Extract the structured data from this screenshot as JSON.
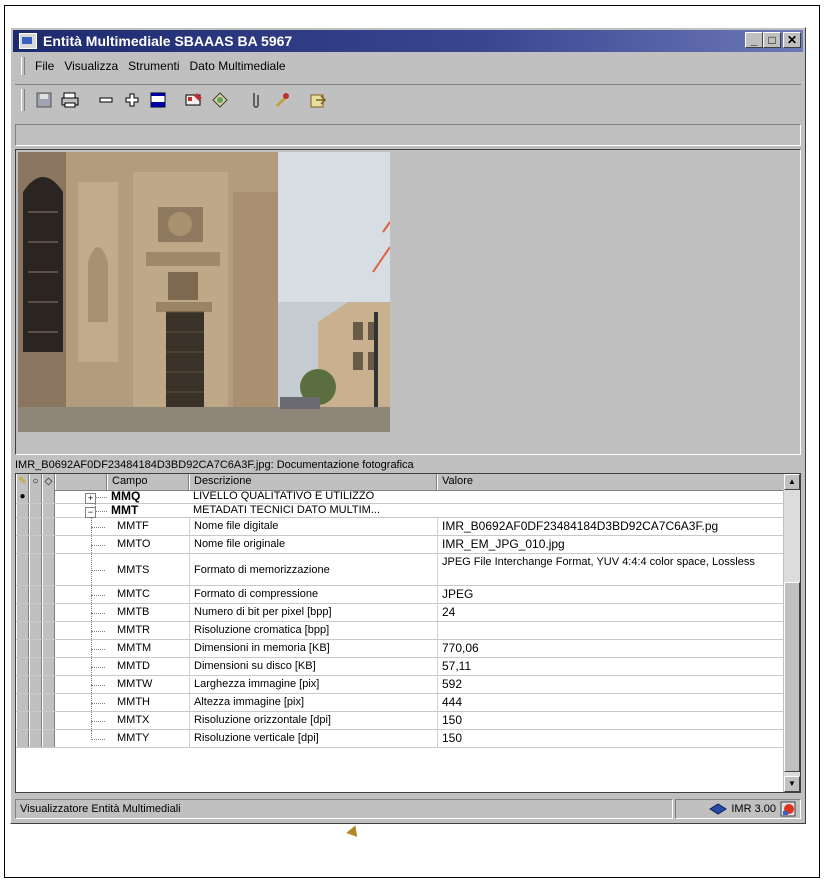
{
  "window": {
    "title": "Entità Multimediale SBAAAS BA 5967"
  },
  "titlebar_buttons": {
    "minimize": "_",
    "maximize": "□",
    "close": "✕"
  },
  "menu": [
    "File",
    "Visualizza",
    "Strumenti",
    "Dato Multimediale"
  ],
  "toolbar": [
    "save-icon",
    "print-icon",
    "remove-icon",
    "add-icon",
    "window-icon",
    "id-card-icon",
    "image-icon",
    "attach-icon",
    "tool-icon",
    "export-icon"
  ],
  "caption": "IMR_B0692AF0DF23484184D3BD92CA7C6A3F.jpg: Documentazione fotografica",
  "grid": {
    "headers": {
      "campo": "Campo",
      "descrizione": "Descrizione",
      "valore": "Valore"
    },
    "groups": [
      {
        "expand": "+",
        "campo": "MMQ",
        "descrizione": "LIVELLO QUALITATIVO E UTILIZZO"
      },
      {
        "expand": "−",
        "campo": "MMT",
        "descrizione": "METADATI TECNICI DATO MULTIM..."
      }
    ],
    "rows": [
      {
        "campo": "MMTF",
        "descrizione": "Nome file digitale",
        "valore": "IMR_B0692AF0DF23484184D3BD92CA7C6A3F.pg"
      },
      {
        "campo": "MMTO",
        "descrizione": "Nome file originale",
        "valore": "IMR_EM_JPG_010.jpg"
      },
      {
        "campo": "MMTS",
        "descrizione": "Formato di memorizzazione",
        "valore": "JPEG File Interchange Format, YUV 4:4:4 color space, Lossless"
      },
      {
        "campo": "MMTC",
        "descrizione": "Formato di compressione",
        "valore": "JPEG"
      },
      {
        "campo": "MMTB",
        "descrizione": "Numero di bit per pixel [bpp]",
        "valore": "24"
      },
      {
        "campo": "MMTR",
        "descrizione": "Risoluzione cromatica [bpp]",
        "valore": ""
      },
      {
        "campo": "MMTM",
        "descrizione": "Dimensioni in memoria [KB]",
        "valore": "770,06"
      },
      {
        "campo": "MMTD",
        "descrizione": "Dimensioni su disco [KB]",
        "valore": "57,11"
      },
      {
        "campo": "MMTW",
        "descrizione": "Larghezza immagine [pix]",
        "valore": "592"
      },
      {
        "campo": "MMTH",
        "descrizione": "Altezza immagine [pix]",
        "valore": "444"
      },
      {
        "campo": "MMTX",
        "descrizione": "Risoluzione orizzontale [dpi]",
        "valore": "150"
      },
      {
        "campo": "MMTY",
        "descrizione": "Risoluzione verticale [dpi]",
        "valore": "150"
      }
    ]
  },
  "status": {
    "left": "Visualizzatore Entità Multimediali",
    "right": "IMR 3.00"
  },
  "colors": {
    "titlebar": "#1e2a6e",
    "window": "#c0c0c0"
  }
}
